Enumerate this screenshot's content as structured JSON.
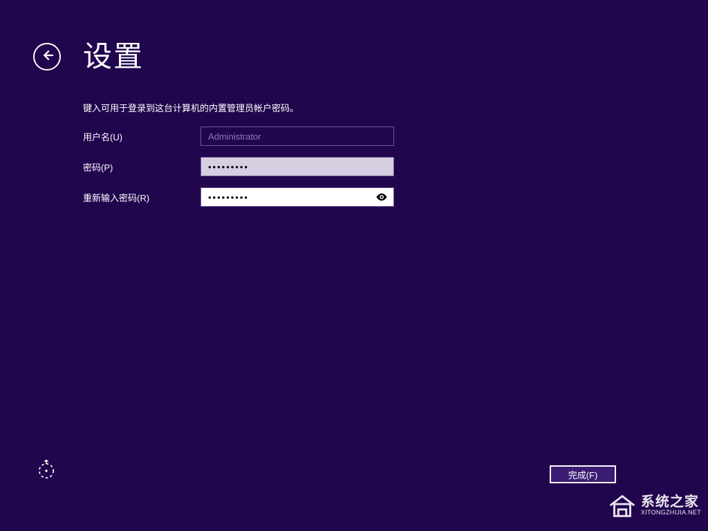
{
  "header": {
    "title": "设置"
  },
  "instruction": "键入可用于登录到这台计算机的内置管理员帐户密码。",
  "form": {
    "username": {
      "label": "用户名(U)",
      "value": "Administrator"
    },
    "password": {
      "label": "密码(P)",
      "mask": "•••••••••"
    },
    "confirm": {
      "label": "重新输入密码(R)",
      "mask": "•••••••••"
    }
  },
  "footer": {
    "finish_label": "完成(F)"
  },
  "watermark": {
    "text_cn": "系统之家",
    "text_en": "XITONGZHIJIA.NET"
  }
}
